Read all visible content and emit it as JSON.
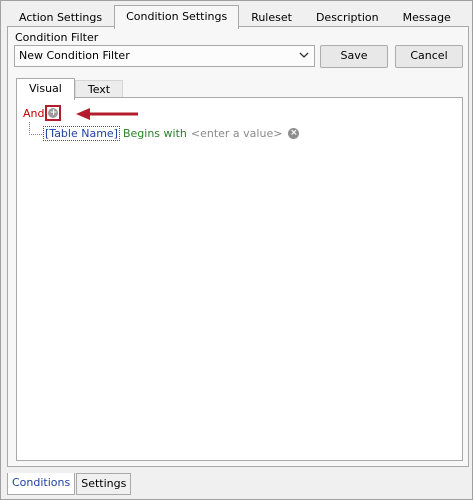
{
  "top_tabs": [
    "Action Settings",
    "Condition Settings",
    "Ruleset",
    "Description",
    "Message"
  ],
  "condition_filter": {
    "label": "Condition Filter",
    "selected": "New Condition Filter",
    "save_label": "Save",
    "cancel_label": "Cancel"
  },
  "inner_tabs": [
    "Visual",
    "Text"
  ],
  "editor": {
    "group_operator": "And",
    "condition": {
      "field": "[Table Name]",
      "operator": "Begins with",
      "value_placeholder": "<enter a value>"
    }
  },
  "bottom_tabs": [
    "Conditions",
    "Settings"
  ],
  "colors": {
    "group_operator": "#c00000",
    "field": "#1f3fa6",
    "operator": "#2a7f2a",
    "highlight_arrow": "#b41c2e"
  },
  "icons": {
    "add_condition": "plus-circle-icon",
    "remove_condition": "x-circle-icon",
    "dropdown": "chevron-down-icon"
  }
}
